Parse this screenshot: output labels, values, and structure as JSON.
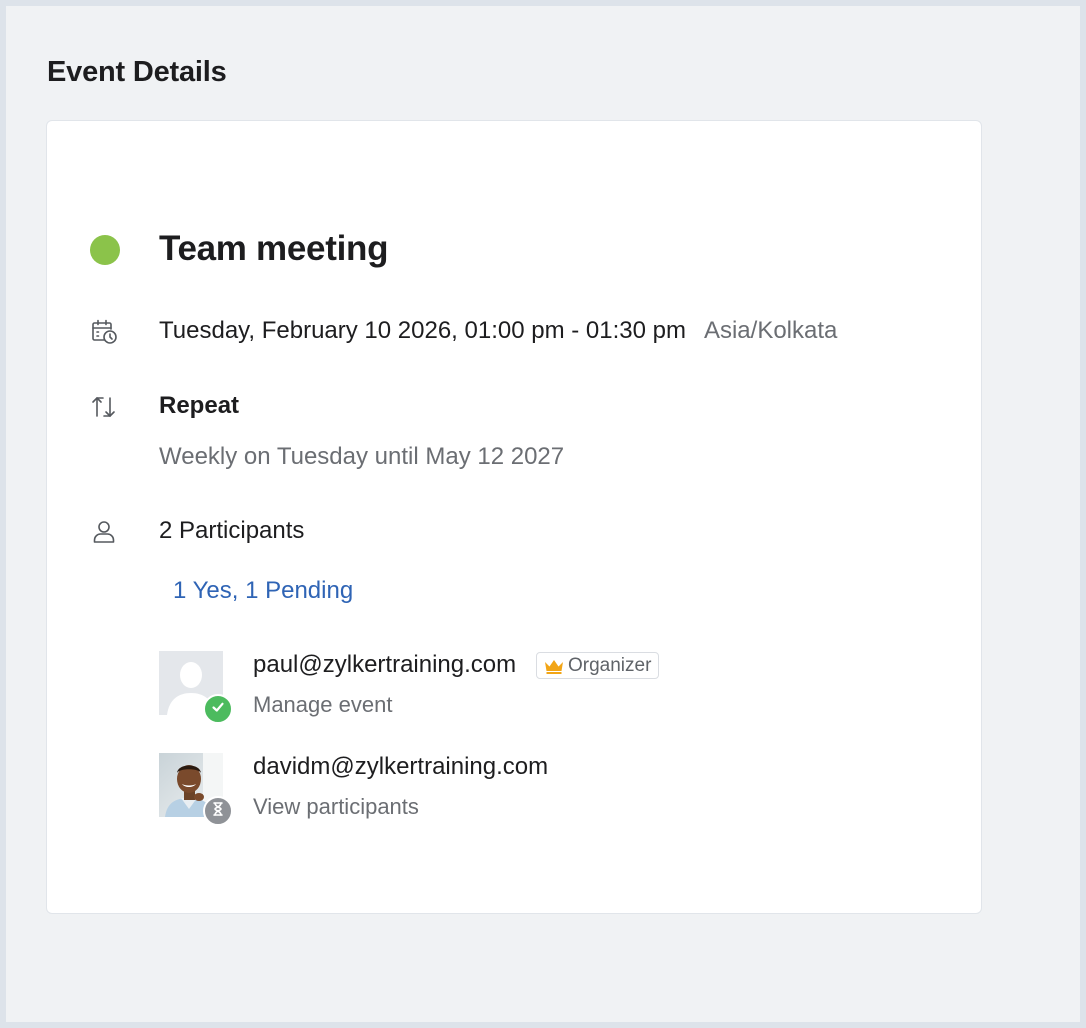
{
  "page": {
    "title": "Event Details"
  },
  "event": {
    "title": "Team meeting",
    "status_color": "#8bc34a",
    "datetime": "Tuesday, February 10 2026, 01:00 pm - 01:30 pm",
    "timezone": "Asia/Kolkata",
    "repeat_label": "Repeat",
    "repeat_rule": "Weekly on Tuesday until May 12 2027",
    "participants_count": "2 Participants",
    "rsvp_summary": "1 Yes, 1 Pending"
  },
  "participants": [
    {
      "email": "paul@zylkertraining.com",
      "role_badge": "Organizer",
      "action": "Manage event",
      "status": "yes",
      "avatar": "default-avatar"
    },
    {
      "email": "davidm@zylkertraining.com",
      "action": "View participants",
      "status": "pending",
      "avatar": "photo-avatar"
    }
  ],
  "icons": {
    "datetime": "calendar-clock-icon",
    "repeat": "repeat-arrows-icon",
    "participants": "person-icon",
    "organizer": "crown-icon",
    "accepted": "check-icon",
    "pending": "hourglass-icon"
  },
  "colors": {
    "link": "#2f64b5",
    "accepted": "#4cbb5e",
    "pending": "#8f9297",
    "crown": "#f2a516"
  }
}
